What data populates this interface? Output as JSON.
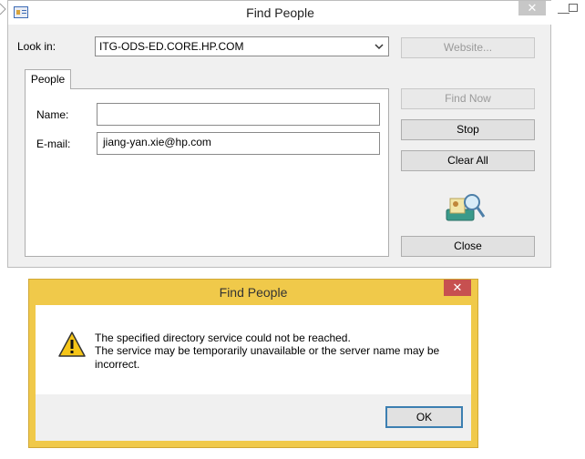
{
  "find_people": {
    "title": "Find People",
    "close_glyph": "✕",
    "look_in_label": "Look in:",
    "look_in_value": "ITG-ODS-ED.CORE.HP.COM",
    "website_button": "Website...",
    "tab_label": "People",
    "name_label": "Name:",
    "name_value": "",
    "email_label": "E-mail:",
    "email_value": "jiang-yan.xie@hp.com",
    "find_now_button": "Find Now",
    "stop_button": "Stop",
    "clear_all_button": "Clear All",
    "close_button": "Close",
    "icons": {
      "app": "address-book-icon",
      "dropdown": "chevron-down-icon",
      "search": "directory-search-icon"
    }
  },
  "error_dialog": {
    "title": "Find People",
    "close_glyph": "✕",
    "message_line1": "The specified directory service could not be reached.",
    "message_line2": "The service may be temporarily unavailable or the server name may be incorrect.",
    "ok_button": "OK",
    "icon": "warning-icon"
  },
  "background_window": {
    "minimize_glyph": "—",
    "icons": [
      "minimize-icon",
      "maximize-icon"
    ]
  },
  "colors": {
    "dialog_frame": "#f0c94a",
    "error_close": "#c75050",
    "window_bg": "#f0f0f0",
    "focus_border": "#3c7fb1"
  }
}
